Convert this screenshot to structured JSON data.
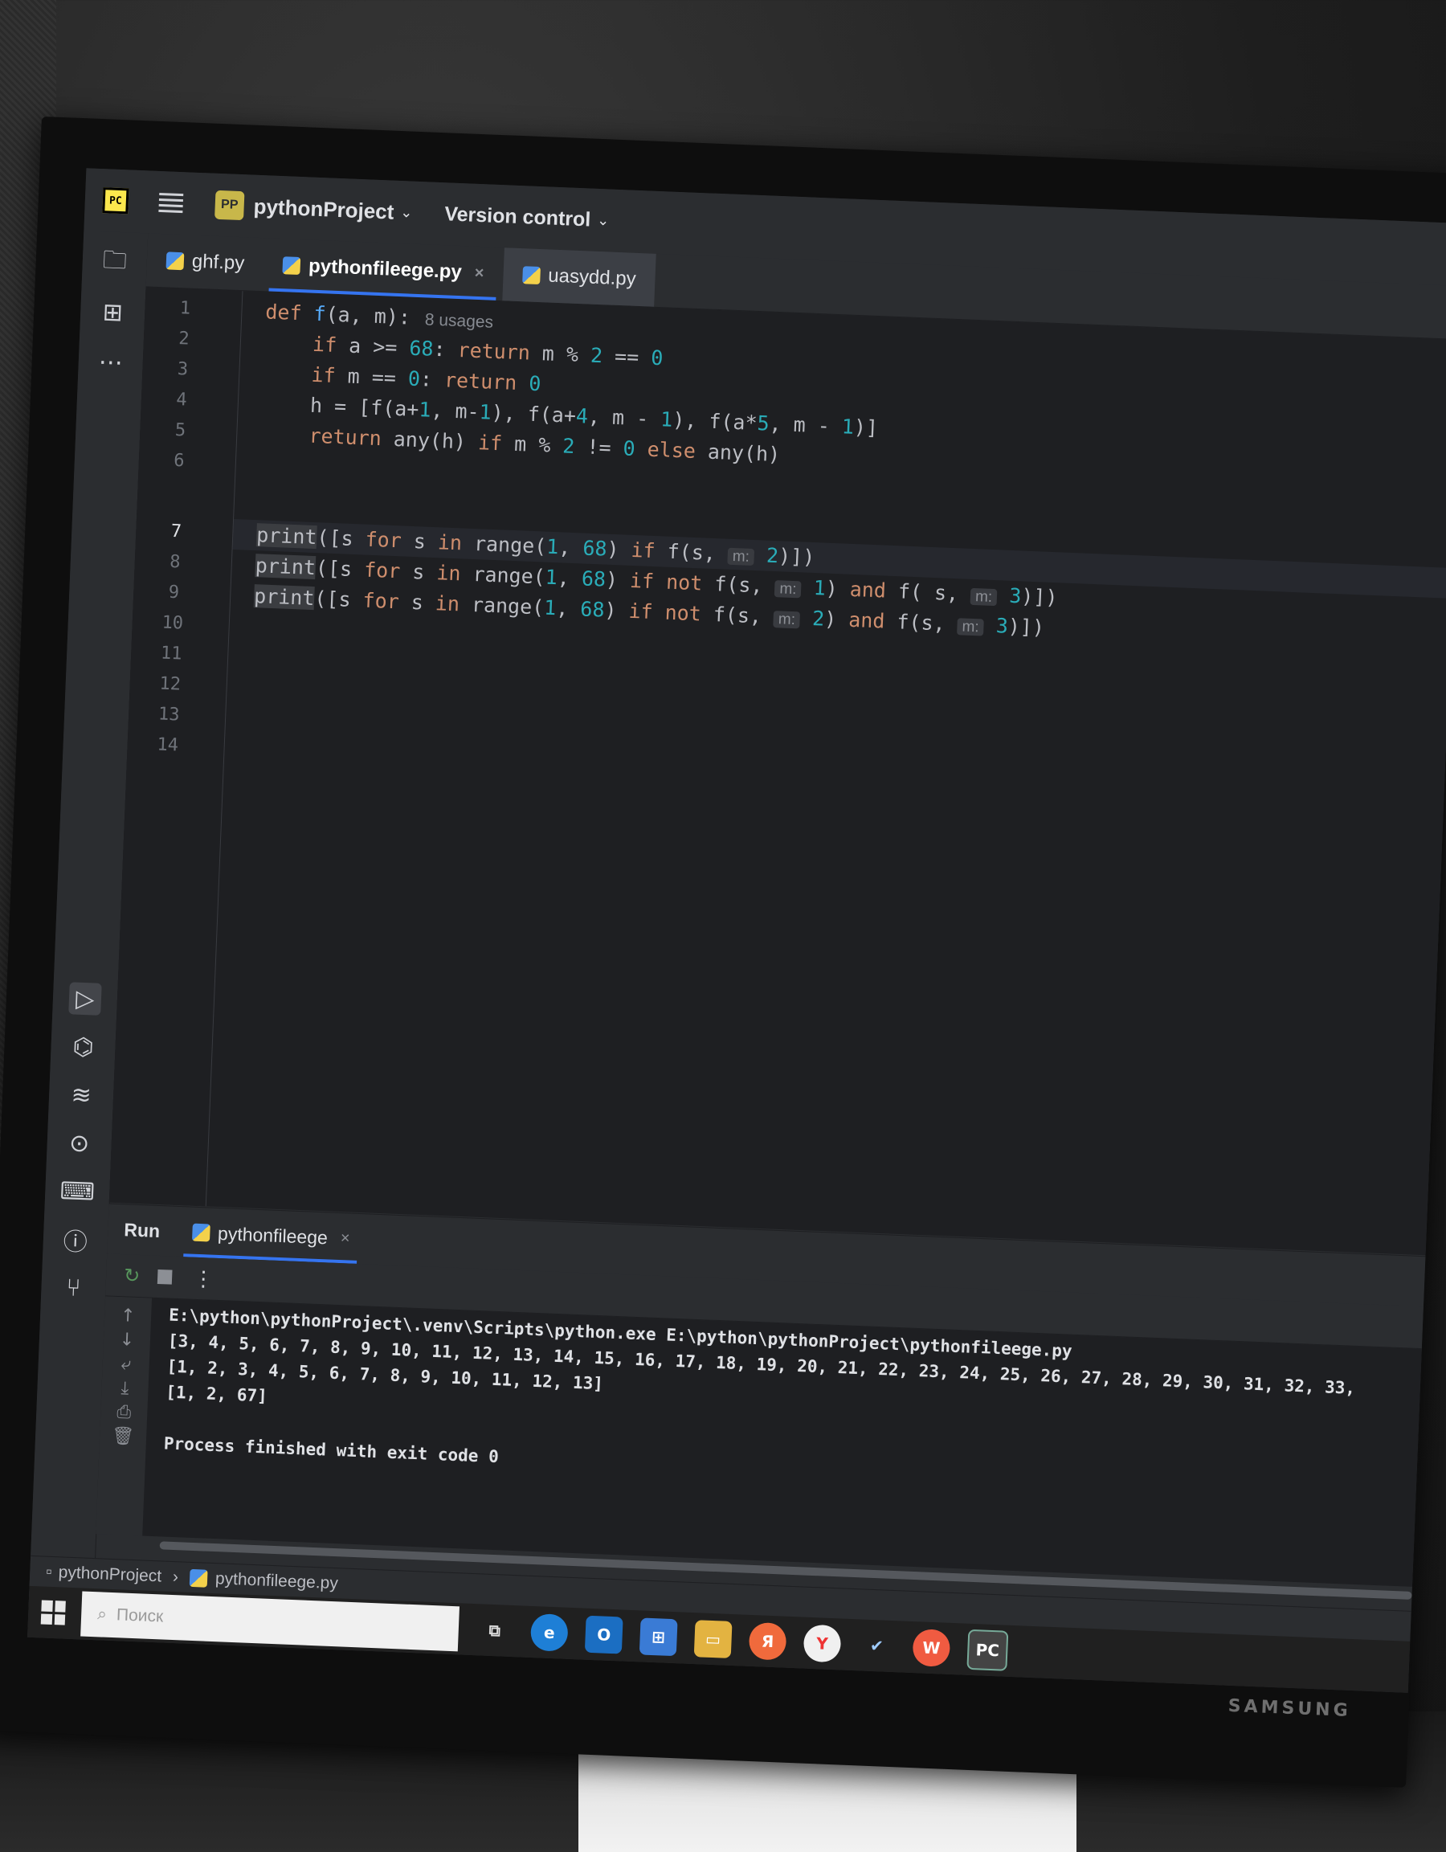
{
  "topbar": {
    "logo": "PC",
    "project_badge": "PP",
    "project_name": "pythonProject",
    "vcs_label": "Version control"
  },
  "tabs": [
    {
      "label": "ghf.py"
    },
    {
      "label": "pythonfileege.py"
    },
    {
      "label": "uasydd.py"
    }
  ],
  "editor": {
    "line_numbers": [
      "1",
      "2",
      "3",
      "4",
      "5",
      "6",
      "7",
      "8",
      "9",
      "10",
      "11",
      "12",
      "13",
      "14"
    ],
    "current_line": "7",
    "usages_hint": "8 usages",
    "param_hint": "m:"
  },
  "run": {
    "title": "Run",
    "tab_label": "pythonfileege",
    "console": [
      "E:\\python\\pythonProject\\.venv\\Scripts\\python.exe E:\\python\\pythonProject\\pythonfileege.py",
      "[3, 4, 5, 6, 7, 8, 9, 10, 11, 12, 13, 14, 15, 16, 17, 18, 19, 20, 21, 22, 23, 24, 25, 26, 27, 28, 29, 30, 31, 32, 33,",
      "[1, 2, 3, 4, 5, 6, 7, 8, 9, 10, 11, 12, 13]",
      "[1, 2, 67]",
      "",
      "Process finished with exit code 0"
    ]
  },
  "status": {
    "crumb_project": "pythonProject",
    "crumb_file": "pythonfileege.py"
  },
  "taskbar": {
    "search_placeholder": "Поиск"
  },
  "monitor_brand": "SAMSUNG",
  "colors": {
    "accent": "#3574f0",
    "keyword": "#cf8e6d",
    "number": "#2aacb8",
    "editor_bg": "#1e1f22"
  }
}
